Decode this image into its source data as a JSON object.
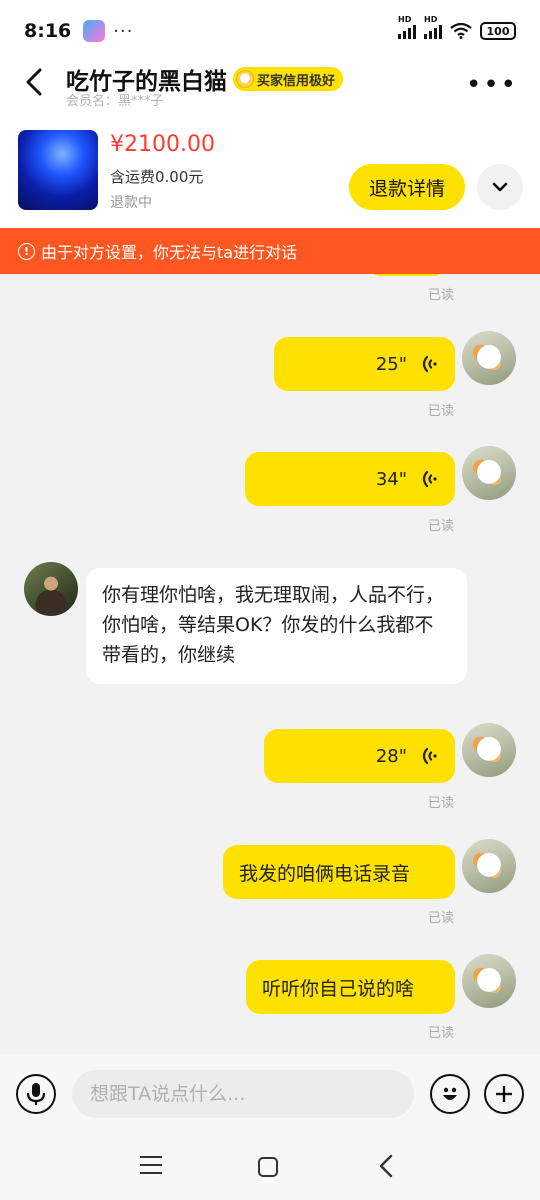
{
  "status_bar": {
    "time": "8:16",
    "dots": "···",
    "battery": "100",
    "signal_label": "HD"
  },
  "header": {
    "title": "吃竹子的黑白猫",
    "credit_badge": "买家信用极好",
    "member_name": "会员名：黑***子"
  },
  "product": {
    "price": "¥2100.00",
    "shipping": "含运费0.00元",
    "status": "退款中",
    "refund_button": "退款详情"
  },
  "banner": {
    "icon": "!",
    "text": "由于对方设置，你无法与ta进行对话"
  },
  "messages": {
    "read_label": "已读",
    "voice1": "25\"",
    "voice2": "34\"",
    "incoming": "你有理你怕啥，我无理取闹，人品不行，你怕啥，等结果OK？你发的什么我都不带看的，你继续",
    "voice3": "28\"",
    "text1": "我发的咱俩电话录音",
    "text2": "听听你自己说的啥"
  },
  "input": {
    "placeholder": "想跟TA说点什么..."
  },
  "colors": {
    "accent_yellow": "#ffe100",
    "banner_orange": "#ff5722",
    "price_red": "#ff3b30"
  }
}
